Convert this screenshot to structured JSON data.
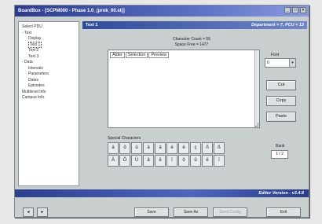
{
  "window": {
    "title": "BoardBox - [SCPM000 - Phase 1.0_(prok_00.st)]",
    "controls": [
      "_",
      "□",
      "×"
    ]
  },
  "tree": {
    "items": [
      {
        "label": "Select PDU",
        "level": 0
      },
      {
        "label": "- Text",
        "level": 0
      },
      {
        "label": "Display",
        "level": 1
      },
      {
        "label": "Text 1",
        "level": 1,
        "selected": true
      },
      {
        "label": "Text 2",
        "level": 1
      },
      {
        "label": "Text 3",
        "level": 1
      },
      {
        "label": "- Data",
        "level": 0
      },
      {
        "label": "Intervals",
        "level": 1
      },
      {
        "label": "Parameters",
        "level": 1
      },
      {
        "label": "Dates",
        "level": 1
      },
      {
        "label": "Episodes",
        "level": 1
      },
      {
        "label": "Multilevel Info",
        "level": 0
      },
      {
        "label": "Campus Info",
        "level": 0
      }
    ]
  },
  "panel": {
    "title": "Text 1",
    "right": "Department = 7, PCU = 13"
  },
  "counts": {
    "characters": "Character Count = 55",
    "space": "Space Free = 1477"
  },
  "editor": {
    "tags": [
      "Alder",
      "Selection",
      "Preview"
    ],
    "content": ""
  },
  "font": {
    "label": "Font",
    "value": "0"
  },
  "buttons": {
    "cut": "Cut",
    "copy": "Copy",
    "paste": "Paste"
  },
  "special": {
    "label": "Special Characters",
    "chars": [
      "ä",
      "ö",
      "ü",
      "à",
      "á",
      "é",
      "è",
      "ç",
      "ñ",
      "ß",
      "Ä",
      "Ö",
      "Ü",
      "â",
      "ê",
      "î",
      "ô",
      "û",
      "ë",
      "ï"
    ]
  },
  "bank": {
    "label": "Bank",
    "value": "1 / 2"
  },
  "status": {
    "text": "Editor Version - v3.4.8"
  },
  "nav": {
    "prev": "◄",
    "next": "►"
  },
  "bottom": {
    "save": "Save",
    "save_as": "Save As",
    "disabled": "Send Config",
    "exit": "Exit"
  }
}
